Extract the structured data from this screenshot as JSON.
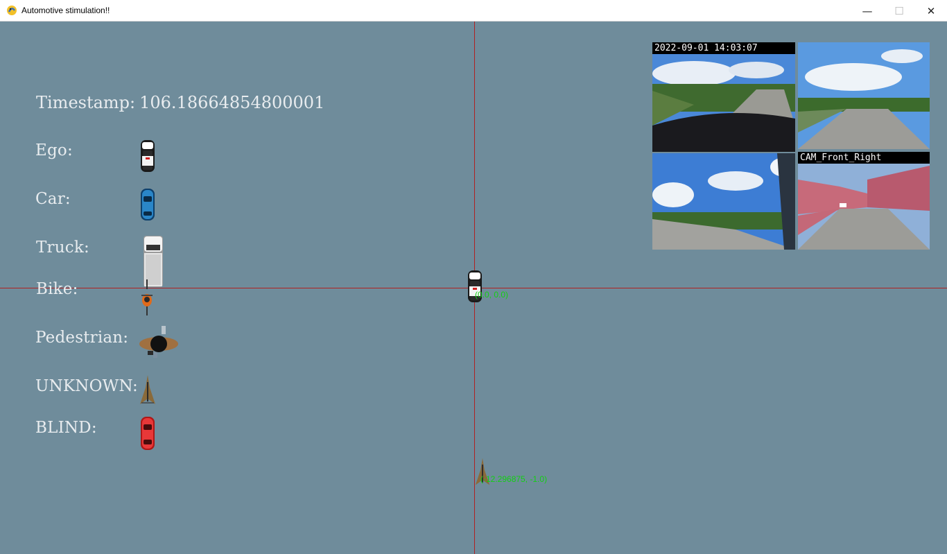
{
  "window": {
    "title": "Automotive stimulation!!",
    "controls": {
      "minimize": "—",
      "maximize": "☐",
      "close": "✕"
    }
  },
  "hud": {
    "timestamp_label": "Timestamp:",
    "timestamp_value": "106.18664854800001"
  },
  "legend": [
    {
      "label": "Ego:",
      "icon": "ego-car-icon"
    },
    {
      "label": "Car:",
      "icon": "car-icon"
    },
    {
      "label": "Truck:",
      "icon": "truck-icon"
    },
    {
      "label": "Bike:",
      "icon": "bike-icon"
    },
    {
      "label": "Pedestrian:",
      "icon": "pedestrian-icon"
    },
    {
      "label": "UNKNOWN:",
      "icon": "unknown-object-icon"
    },
    {
      "label": "BLIND:",
      "icon": "blind-car-icon"
    }
  ],
  "scene": {
    "ego_coord": "(0.0, 0.0)",
    "object_coord": "(-12.296875, -1.0)"
  },
  "cameras": {
    "front_timestamp": "2022-09-01 14:03:07",
    "front_right_label": "CAM_Front_Right"
  },
  "colors": {
    "background": "#6f8c9b",
    "axis": "#b02020",
    "coord_text": "#12d012",
    "label_text": "#e8ecef"
  }
}
